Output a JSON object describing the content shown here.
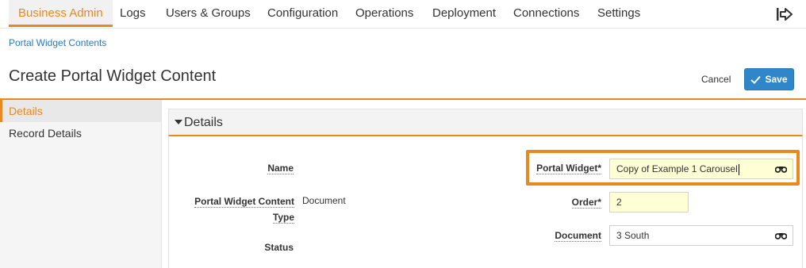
{
  "nav": {
    "items": [
      "Business Admin",
      "Logs",
      "Users & Groups",
      "Configuration",
      "Operations",
      "Deployment",
      "Connections",
      "Settings"
    ],
    "active_index": 0,
    "accent_color": "#e8891d",
    "logout_icon": "logout-icon"
  },
  "breadcrumb": "Portal Widget Contents",
  "page_title": "Create Portal Widget Content",
  "actions": {
    "cancel_label": "Cancel",
    "save_label": "Save",
    "save_icon": "check-icon",
    "save_color": "#2f86c9"
  },
  "sidebar": {
    "items": [
      "Details",
      "Record Details"
    ],
    "active_index": 0
  },
  "section": {
    "title": "Details",
    "expanded": true
  },
  "form": {
    "name": {
      "label": "Name",
      "value": ""
    },
    "type": {
      "label_line1": "Portal Widget Content",
      "label_line2": "Type",
      "value": "Document"
    },
    "status": {
      "label": "Status",
      "value": ""
    },
    "portal_widget": {
      "label": "Portal Widget*",
      "value": "Copy of Example 1 Carousel",
      "icon": "binoculars-icon"
    },
    "order": {
      "label": "Order*",
      "value": "2"
    },
    "document": {
      "label": "Document",
      "value": "3 South",
      "icon": "binoculars-icon"
    }
  }
}
